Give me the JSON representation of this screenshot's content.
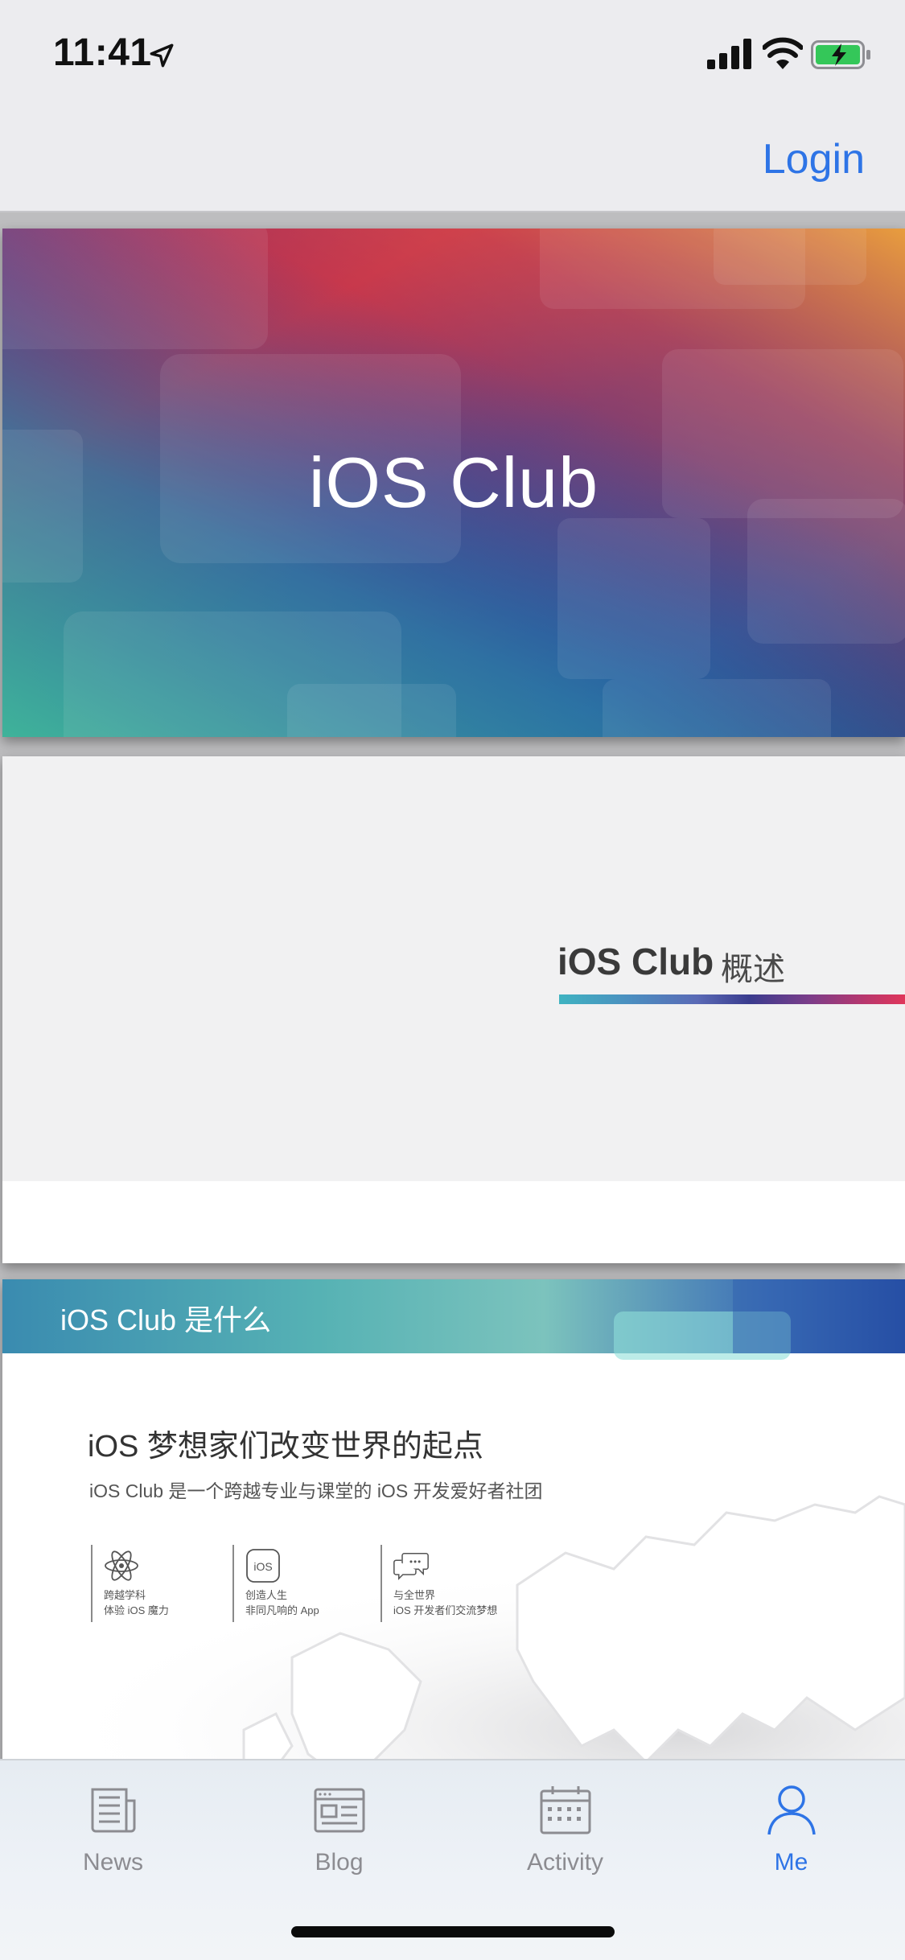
{
  "status_bar": {
    "time": "11:41"
  },
  "nav": {
    "login_label": "Login"
  },
  "slides": {
    "cover": {
      "title": "iOS Club"
    },
    "overview": {
      "title": "iOS Club",
      "subtitle": "概述"
    },
    "what_is": {
      "header": "iOS Club 是什么",
      "heading": "iOS 梦想家们改变世界的起点",
      "description": "iOS Club 是一个跨越专业与课堂的 iOS 开发爱好者社团",
      "features": [
        {
          "icon": "atom-icon",
          "line1": "跨越学科",
          "line2": "体验 iOS 魔力"
        },
        {
          "icon": "ios-badge-icon",
          "line1": "创造人生",
          "line2": "非同凡响的 App"
        },
        {
          "icon": "chat-bubbles-icon",
          "line1": "与全世界",
          "line2": "iOS 开发者们交流梦想"
        }
      ]
    }
  },
  "tabs": [
    {
      "label": "News",
      "icon": "newspaper-icon",
      "active": false
    },
    {
      "label": "Blog",
      "icon": "blog-icon",
      "active": false
    },
    {
      "label": "Activity",
      "icon": "calendar-icon",
      "active": false
    },
    {
      "label": "Me",
      "icon": "person-icon",
      "active": true
    }
  ],
  "colors": {
    "accent": "#2e74e6",
    "tab_inactive": "#8c8c91"
  }
}
